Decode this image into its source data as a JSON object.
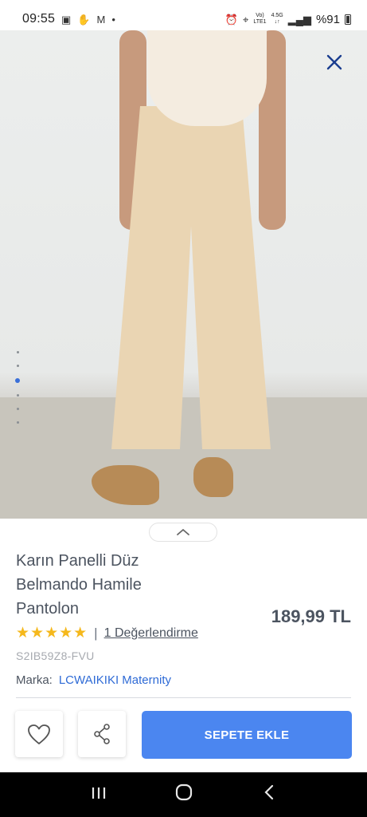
{
  "status_bar": {
    "time": "09:55",
    "left_icons": [
      "image-icon",
      "hand-icon",
      "mail-icon",
      "dot-icon"
    ],
    "net_top": "Vo)",
    "net_bottom": "LTE1",
    "net_gen": "4.5G",
    "battery": "%91"
  },
  "hero": {
    "image_dots_count": 6,
    "active_dot": 2
  },
  "product": {
    "title": "Karın Panelli Düz Belmando Hamile Pantolon",
    "price": "189,99 TL",
    "stars": "★★★★★",
    "rating_value": 5,
    "separator": "|",
    "reviews": "1 Değerlendirme",
    "sku": "S2IB59Z8-FVU",
    "brand_label": "Marka:",
    "brand": "LCWAIKIKI Maternity"
  },
  "actions": {
    "cart_label": "SEPETE EKLE"
  },
  "colors": {
    "accent": "#4b86f0",
    "brand_link": "#2f6bd6",
    "close": "#1a3d8f",
    "stars": "#f5b81c"
  }
}
